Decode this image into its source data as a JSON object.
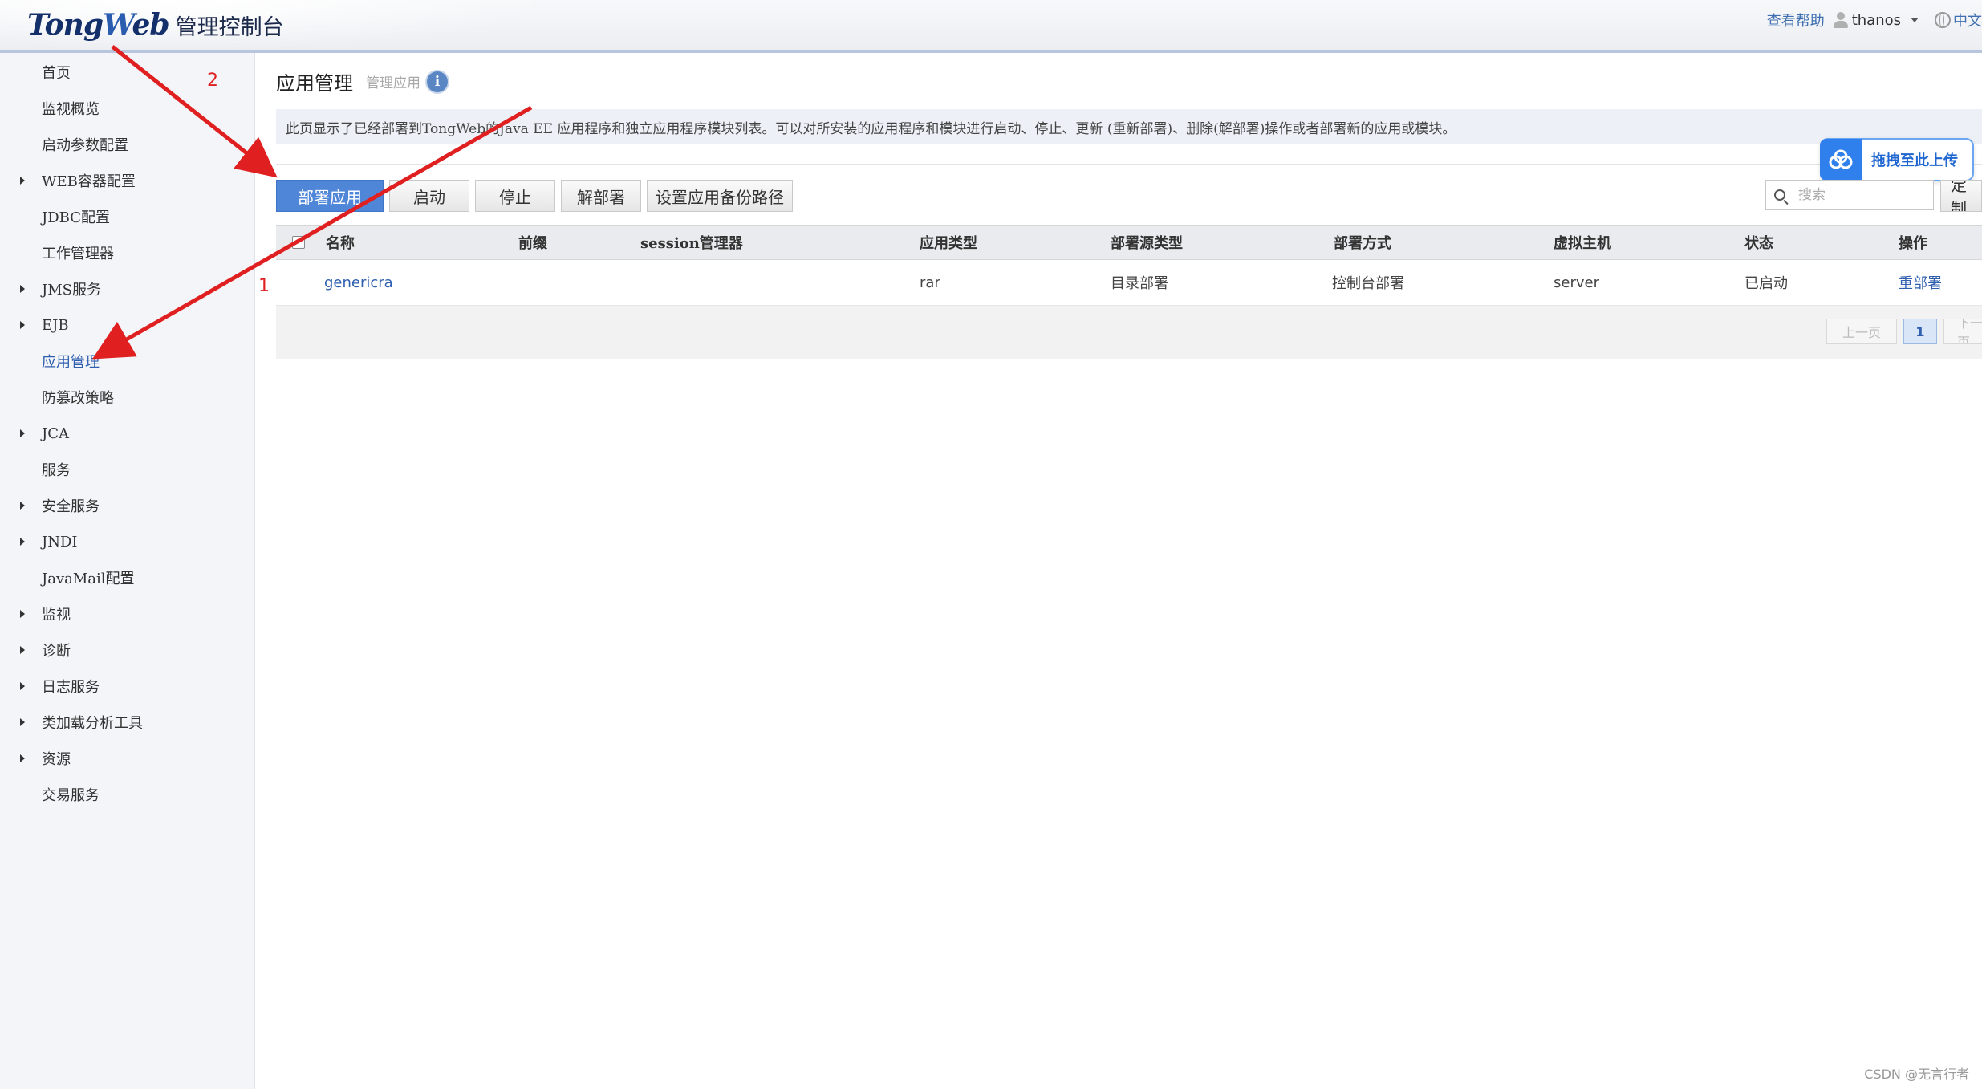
{
  "header": {
    "brand_prefix": "Tong",
    "brand_w": "W",
    "brand_suffix": "eb",
    "console_title": "管理控制台",
    "help_link": "查看帮助",
    "username": "thanos",
    "language": "中文"
  },
  "sidebar": {
    "items": [
      {
        "label": "首页",
        "expandable": false
      },
      {
        "label": "监视概览",
        "expandable": false
      },
      {
        "label": "启动参数配置",
        "expandable": false
      },
      {
        "label": "WEB容器配置",
        "expandable": true
      },
      {
        "label": "JDBC配置",
        "expandable": false
      },
      {
        "label": "工作管理器",
        "expandable": false
      },
      {
        "label": "JMS服务",
        "expandable": true
      },
      {
        "label": "EJB",
        "expandable": true
      },
      {
        "label": "应用管理",
        "expandable": false,
        "active": true
      },
      {
        "label": "防篡改策略",
        "expandable": false
      },
      {
        "label": "JCA",
        "expandable": true
      },
      {
        "label": "服务",
        "expandable": false
      },
      {
        "label": "安全服务",
        "expandable": true
      },
      {
        "label": "JNDI",
        "expandable": true
      },
      {
        "label": "JavaMail配置",
        "expandable": false
      },
      {
        "label": "监视",
        "expandable": true
      },
      {
        "label": "诊断",
        "expandable": true
      },
      {
        "label": "日志服务",
        "expandable": true
      },
      {
        "label": "类加载分析工具",
        "expandable": true
      },
      {
        "label": "资源",
        "expandable": true
      },
      {
        "label": "交易服务",
        "expandable": false
      }
    ]
  },
  "main": {
    "title": "应用管理",
    "subtitle": "管理应用",
    "info_glyph": "i",
    "description": "此页显示了已经部署到TongWeb的Java EE 应用程序和独立应用程序模块列表。可以对所安装的应用程序和模块进行启动、停止、更新 (重新部署)、删除(解部署)操作或者部署新的应用或模块。",
    "toolbar": {
      "deploy": "部署应用",
      "start": "启动",
      "stop": "停止",
      "undeploy": "解部署",
      "backup_path": "设置应用备份路径",
      "customize": "定制"
    },
    "search": {
      "placeholder": "搜索",
      "value": ""
    },
    "upload_hint": "拖拽至此上传",
    "table": {
      "headers": [
        "名称",
        "前缀",
        "session管理器",
        "应用类型",
        "部署源类型",
        "部署方式",
        "虚拟主机",
        "状态",
        "操作"
      ],
      "rows": [
        {
          "name": "genericra",
          "prefix": "",
          "session_manager": "",
          "app_type": "rar",
          "source_type": "目录部署",
          "deploy_mode": "控制台部署",
          "virtual_host": "server",
          "status": "已启动",
          "action": "重部署"
        }
      ]
    },
    "pagination": {
      "prev": "上一页",
      "current": "1",
      "next": "下一页"
    }
  },
  "annotations": {
    "marker_1": "1",
    "marker_2": "2",
    "arrow_color": "#e02020"
  },
  "watermark": "CSDN @无言行者",
  "colors": {
    "primary_button": "#4f86d8",
    "link": "#2f5fae",
    "annotation": "#e02020"
  }
}
